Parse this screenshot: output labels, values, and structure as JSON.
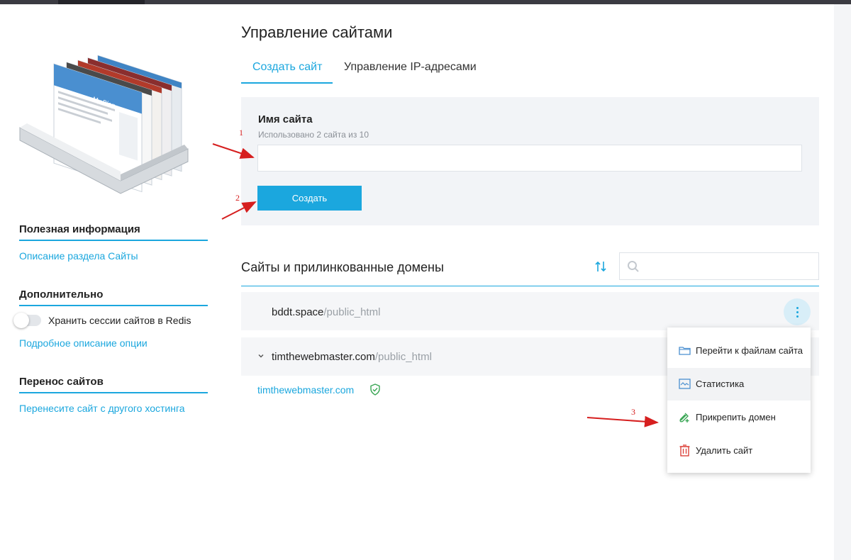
{
  "header": {
    "title": "Управление сайтами",
    "tabs": [
      {
        "label": "Создать сайт",
        "active": true
      },
      {
        "label": "Управление IP-адресами",
        "active": false
      }
    ]
  },
  "sidebar": {
    "illustration_title": "My Blog",
    "useful": {
      "heading": "Полезная информация",
      "link": "Описание раздела Сайты"
    },
    "additional": {
      "heading": "Дополнительно",
      "toggle_label": "Хранить сессии сайтов в Redis",
      "toggle_on": false,
      "link": "Подробное описание опции"
    },
    "transfer": {
      "heading": "Перенос сайтов",
      "link": "Перенесите сайт с другого хостинга"
    }
  },
  "create_form": {
    "label": "Имя сайта",
    "hint": "Использовано 2 сайта из 10",
    "value": "",
    "button": "Создать"
  },
  "sites": {
    "title": "Сайты и прилинкованные домены",
    "search_value": "",
    "items": [
      {
        "domain": "bddt.space",
        "path": "/public_html"
      },
      {
        "domain": "timthewebmaster.com",
        "path": "/public_html",
        "expanded": true,
        "linked": [
          "timthewebmaster.com"
        ]
      }
    ]
  },
  "menu": {
    "items": [
      {
        "label": "Перейти к файлам сайта",
        "icon": "folder-icon"
      },
      {
        "label": "Статистика",
        "icon": "statistics-icon"
      },
      {
        "label": "Прикрепить домен",
        "icon": "attach-domain-icon"
      },
      {
        "label": "Удалить сайт",
        "icon": "trash-icon"
      }
    ]
  },
  "annotations": {
    "one": "1",
    "two": "2",
    "three": "3"
  },
  "colors": {
    "accent": "#1ba7de",
    "panel": "#f2f4f7",
    "annotation": "#d61f1f",
    "ssl_ok": "#3aa655",
    "danger": "#d9342b"
  }
}
